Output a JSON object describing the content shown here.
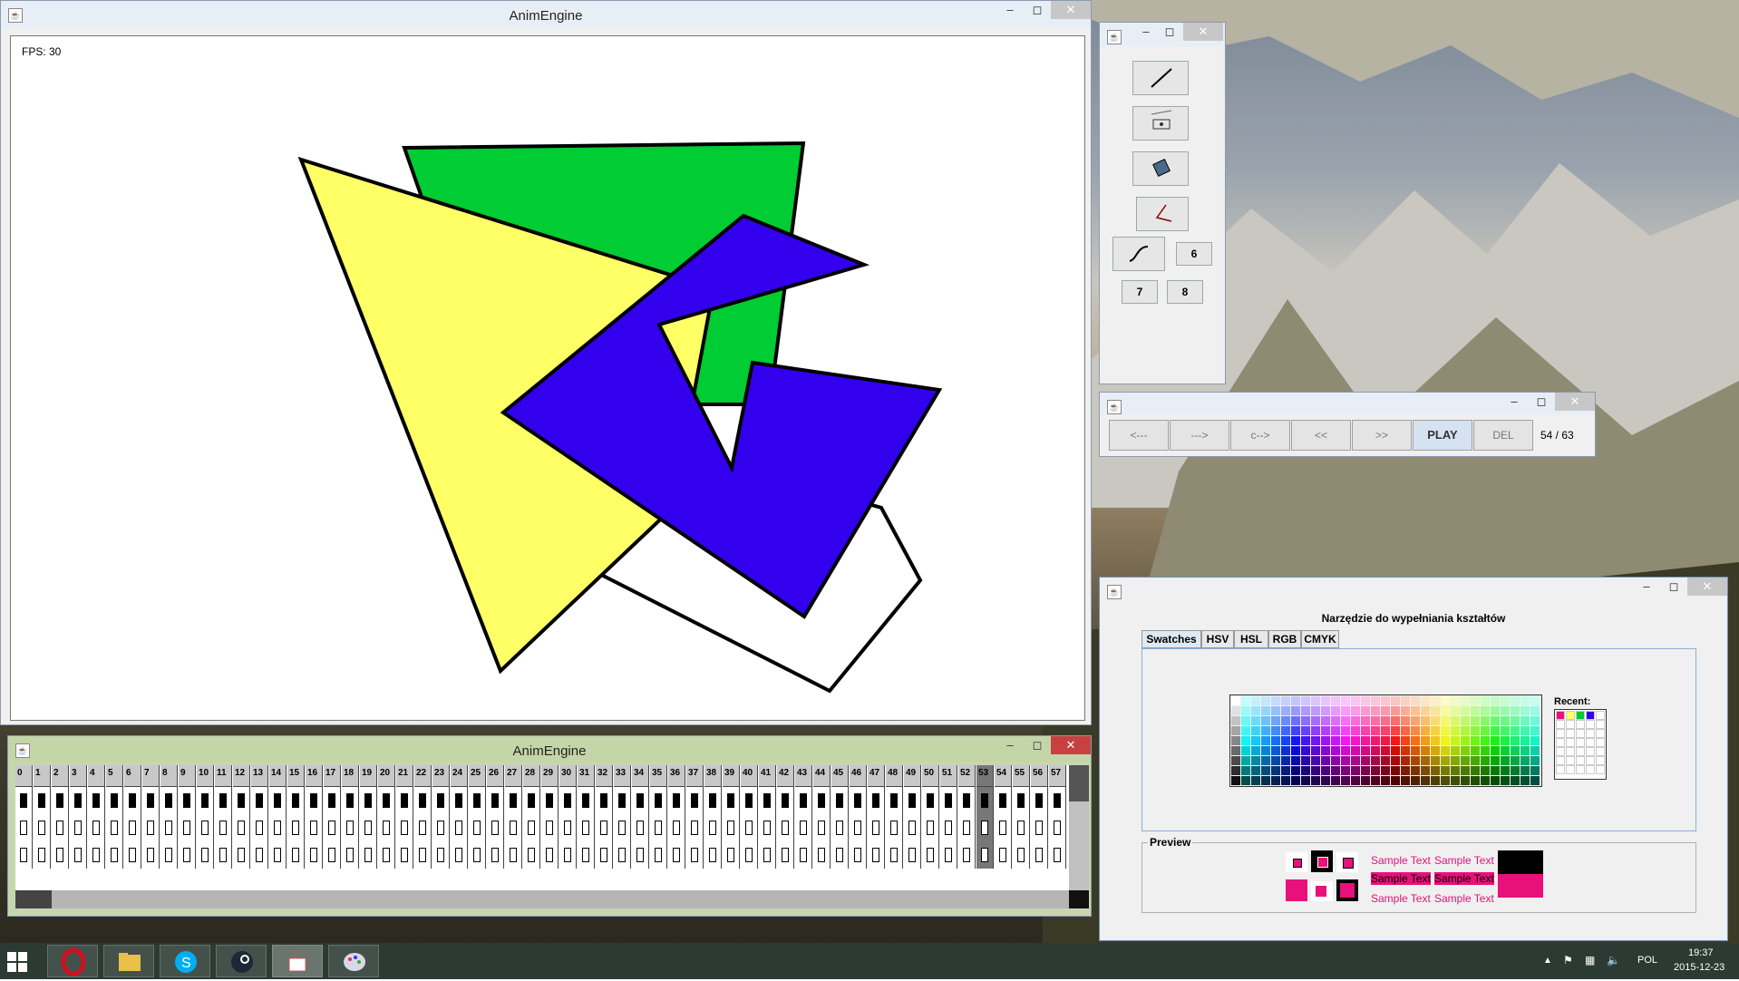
{
  "main_window": {
    "title": "AnimEngine",
    "fps_label": "FPS: 30"
  },
  "timeline_window": {
    "title": "AnimEngine",
    "frames": [
      "0",
      "1",
      "2",
      "3",
      "4",
      "5",
      "6",
      "7",
      "8",
      "9",
      "10",
      "11",
      "12",
      "13",
      "14",
      "15",
      "16",
      "17",
      "18",
      "19",
      "20",
      "21",
      "22",
      "23",
      "24",
      "25",
      "26",
      "27",
      "28",
      "29",
      "30",
      "31",
      "32",
      "33",
      "34",
      "35",
      "36",
      "37",
      "38",
      "39",
      "40",
      "41",
      "42",
      "43",
      "44",
      "45",
      "46",
      "47",
      "48",
      "49",
      "50",
      "51",
      "52",
      "53",
      "54",
      "55",
      "56",
      "57"
    ],
    "current_frame": "53"
  },
  "tools_window": {
    "icons": [
      "line-tool-icon",
      "polygon-tool-icon",
      "fill-tool-icon",
      "curve-edit-tool-icon",
      "bezier-tool-icon"
    ],
    "buttons": {
      "six": "6",
      "seven": "7",
      "eight": "8"
    }
  },
  "playback_window": {
    "buttons": [
      "<---",
      "--->",
      "c-->",
      "<<",
      ">>",
      "PLAY",
      "DEL"
    ],
    "frame_counter": "54 / 63"
  },
  "color_window": {
    "heading": "Narzędzie do wypełniania kształtów",
    "tabs": [
      "Swatches",
      "HSV",
      "HSL",
      "RGB",
      "CMYK"
    ],
    "recent_label": "Recent:",
    "preview_label": "Preview",
    "sample_text": "Sample Text",
    "accent": "#e8107a",
    "recent_colors": [
      "#e8107a",
      "#ffff66",
      "#00cc33",
      "#3300ee",
      "#ffffff"
    ]
  },
  "taskbar": {
    "apps": [
      "opera-icon",
      "file-explorer-icon",
      "skype-icon",
      "steam-icon",
      "java-icon",
      "paint-icon"
    ],
    "language": "POL",
    "time": "19:37",
    "date": "2015-12-23"
  },
  "shapes": {
    "green": "#00cc33",
    "yellow": "#ffff66",
    "blue": "#3300ee"
  }
}
